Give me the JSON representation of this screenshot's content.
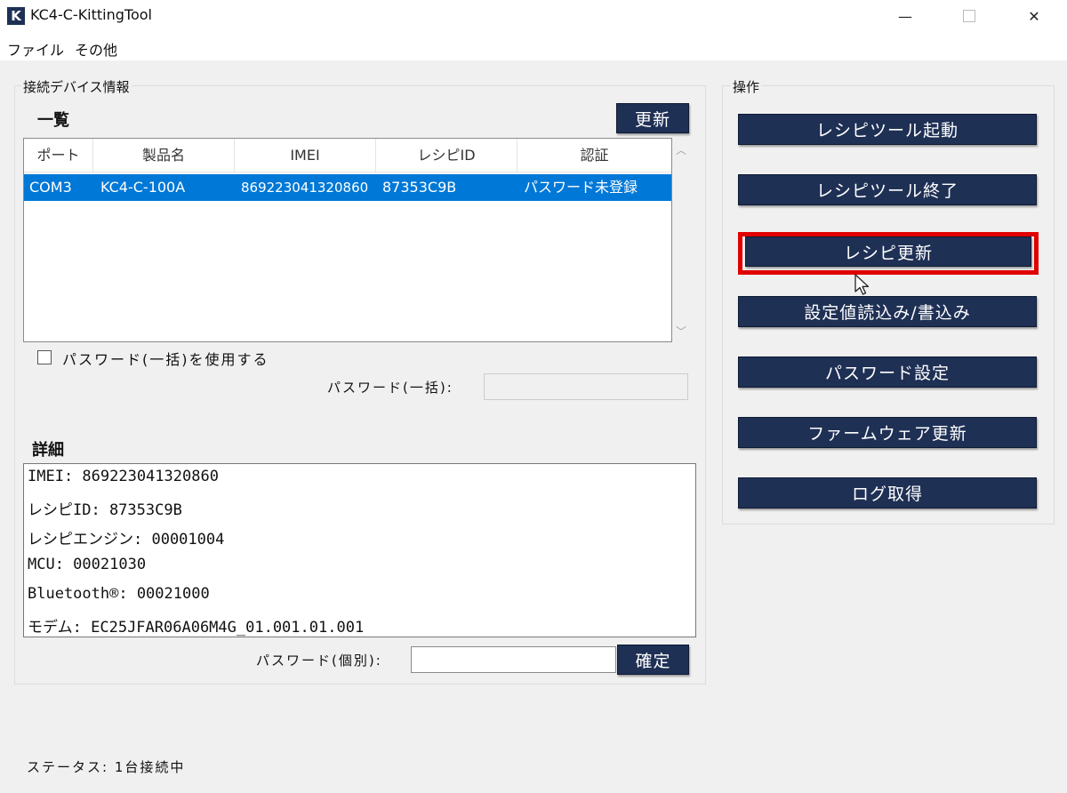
{
  "window": {
    "app_icon_letter": "K",
    "title": "KC4-C-KittingTool",
    "minimize": "—",
    "close": "✕"
  },
  "menu": [
    "ファイル",
    "その他"
  ],
  "left_group": {
    "label": "接続デバイス情報",
    "list_title": "一覧",
    "refresh_button": "更新",
    "columns": [
      "ポート",
      "製品名",
      "IMEI",
      "レシピID",
      "認証"
    ],
    "rows": [
      [
        "COM3",
        "KC4-C-100A",
        "869223041320860",
        "87353C9B",
        "パスワード未登録"
      ]
    ],
    "use_bulk_password_label": "パスワード(一括)を使用する",
    "use_bulk_password_checked": false,
    "bulk_password_label": "パスワード(一括):",
    "bulk_password_value": "",
    "detail_title": "詳細",
    "detail_lines": [
      "IMEI: 869223041320860",
      "レシピID: 87353C9B",
      "レシピエンジン: 00001004",
      "MCU: 00021030",
      "Bluetooth®: 00021000",
      "モデム: EC25JFAR06A06M4G_01.001.01.001"
    ],
    "individual_password_label": "パスワード(個別):",
    "individual_password_value": "",
    "confirm_button": "確定"
  },
  "right_group": {
    "label": "操作",
    "buttons": [
      "レシピツール起動",
      "レシピツール終了",
      "レシピ更新",
      "設定値読込み/書込み",
      "パスワード設定",
      "ファームウェア更新",
      "ログ取得"
    ],
    "highlighted_button_index": 2
  },
  "status": "ステータス: 1台接続中",
  "colors": {
    "button_navy": "#1f3055",
    "selection_blue": "#0078d7",
    "highlight_red": "#e00000"
  }
}
